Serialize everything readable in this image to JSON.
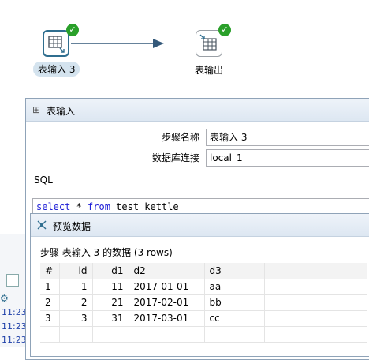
{
  "canvas": {
    "step_input": {
      "label": "表输入 3",
      "status": "success"
    },
    "step_output": {
      "label": "表输出",
      "status": "success"
    },
    "hop": {
      "color": "#34597a"
    },
    "check_glyph": "✓"
  },
  "dialog": {
    "title": "表输入",
    "step_name_label": "步骤名称",
    "step_name_value": "表输入 3",
    "db_connection_label": "数据库连接",
    "db_connection_value": "local_1",
    "sql_label": "SQL",
    "sql": {
      "kw1": "select",
      "mid1": " * ",
      "kw2": "from",
      "rest": " test_kettle"
    }
  },
  "preview": {
    "title": "预览数据",
    "summary": "步骤 表输入 3 的数据  (3 rows)",
    "columns": [
      "#",
      "id",
      "d1",
      "d2",
      "d3"
    ],
    "rows": [
      [
        "1",
        "1",
        "11",
        "2017-01-01",
        "aa"
      ],
      [
        "2",
        "2",
        "21",
        "2017-02-01",
        "bb"
      ],
      [
        "3",
        "3",
        "31",
        "2017-03-01",
        "cc"
      ]
    ]
  },
  "background": {
    "log_times": [
      "11:23",
      "11:23",
      "11:23"
    ]
  },
  "colors": {
    "accent": "#2f6e8f",
    "success": "#2aa02a",
    "sql_keyword": "#1c1cd6"
  }
}
